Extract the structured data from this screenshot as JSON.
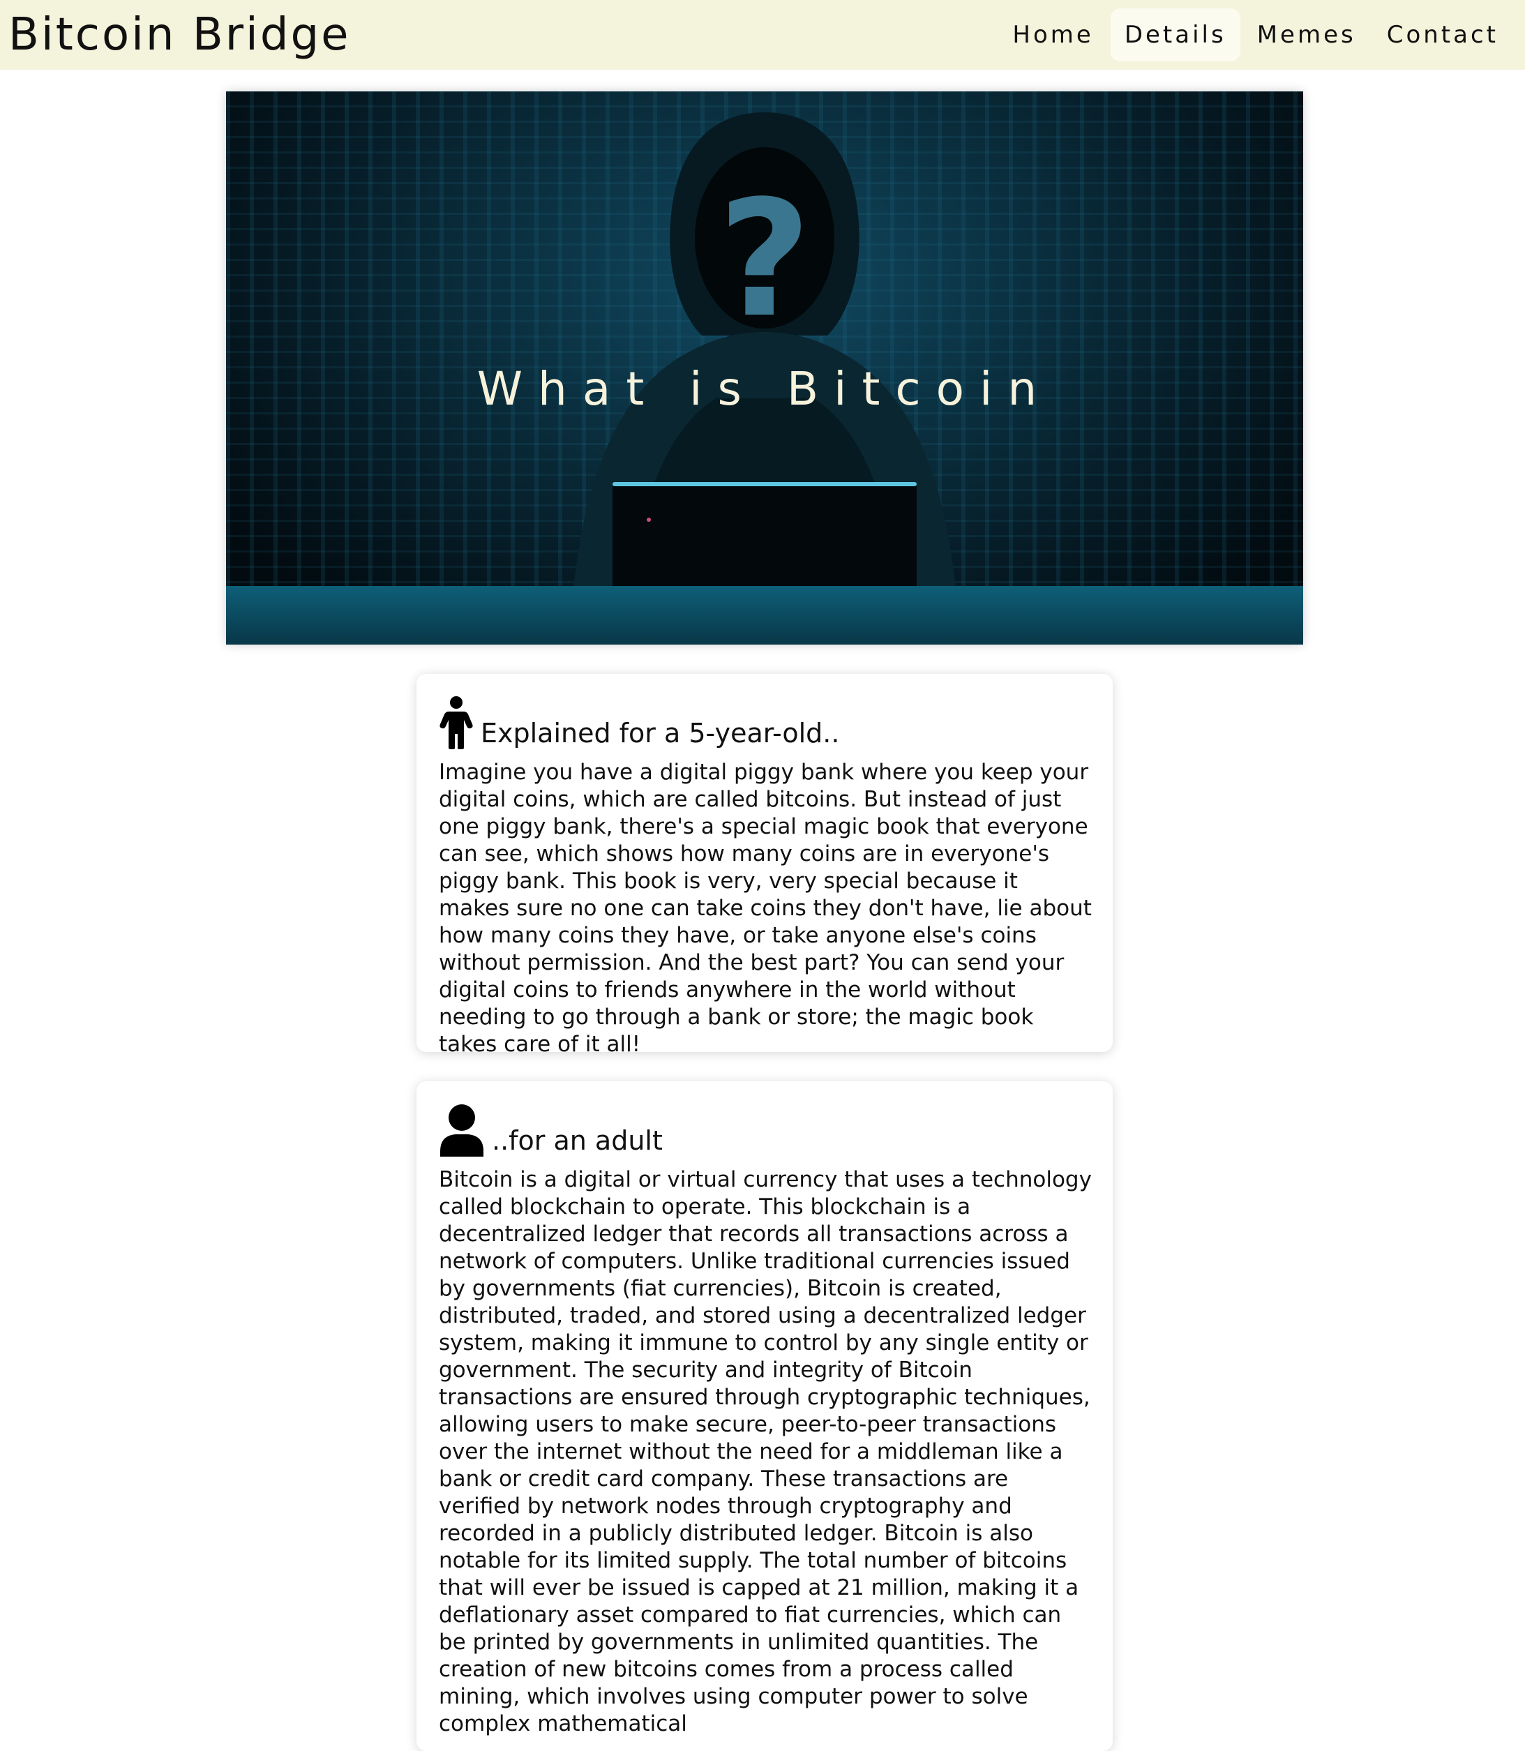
{
  "site": {
    "brand": "Bitcoin Bridge"
  },
  "nav": {
    "items": [
      {
        "label": "Home",
        "active": false
      },
      {
        "label": "Details",
        "active": true
      },
      {
        "label": "Memes",
        "active": false
      },
      {
        "label": "Contact",
        "active": false
      }
    ]
  },
  "hero": {
    "title": "What is Bitcoin",
    "image_description_icon": "hooded-hacker-image"
  },
  "cards": [
    {
      "icon": "child-icon",
      "title": "Explained for a 5-year-old..",
      "body": "Imagine you have a digital piggy bank where you keep your digital coins, which are called bitcoins. But instead of just one piggy bank, there's a special magic book that everyone can see, which shows how many coins are in everyone's piggy bank. This book is very, very special because it makes sure no one can take coins they don't have, lie about how many coins they have, or take anyone else's coins without permission. And the best part? You can send your digital coins to friends anywhere in the world without needing to go through a bank or store; the magic book takes care of it all!"
    },
    {
      "icon": "person-icon",
      "title": "..for an adult",
      "body": "Bitcoin is a digital or virtual currency that uses a technology called blockchain to operate. This blockchain is a decentralized ledger that records all transactions across a network of computers. Unlike traditional currencies issued by governments (fiat currencies), Bitcoin is created, distributed, traded, and stored using a decentralized ledger system, making it immune to control by any single entity or government. The security and integrity of Bitcoin transactions are ensured through cryptographic techniques, allowing users to make secure, peer-to-peer transactions over the internet without the need for a middleman like a bank or credit card company. These transactions are verified by network nodes through cryptography and recorded in a publicly distributed ledger. Bitcoin is also notable for its limited supply. The total number of bitcoins that will ever be issued is capped at 21 million, making it a deflationary asset compared to fiat currencies, which can be printed by governments in unlimited quantities. The creation of new bitcoins comes from a process called mining, which involves using computer power to solve complex mathematical"
    }
  ],
  "colors": {
    "navbar_bg": "#f4f4dc",
    "nav_active_bg": "#fbfbef",
    "hero_title": "#f6f2dc",
    "hero_accent": "#3b7690"
  }
}
